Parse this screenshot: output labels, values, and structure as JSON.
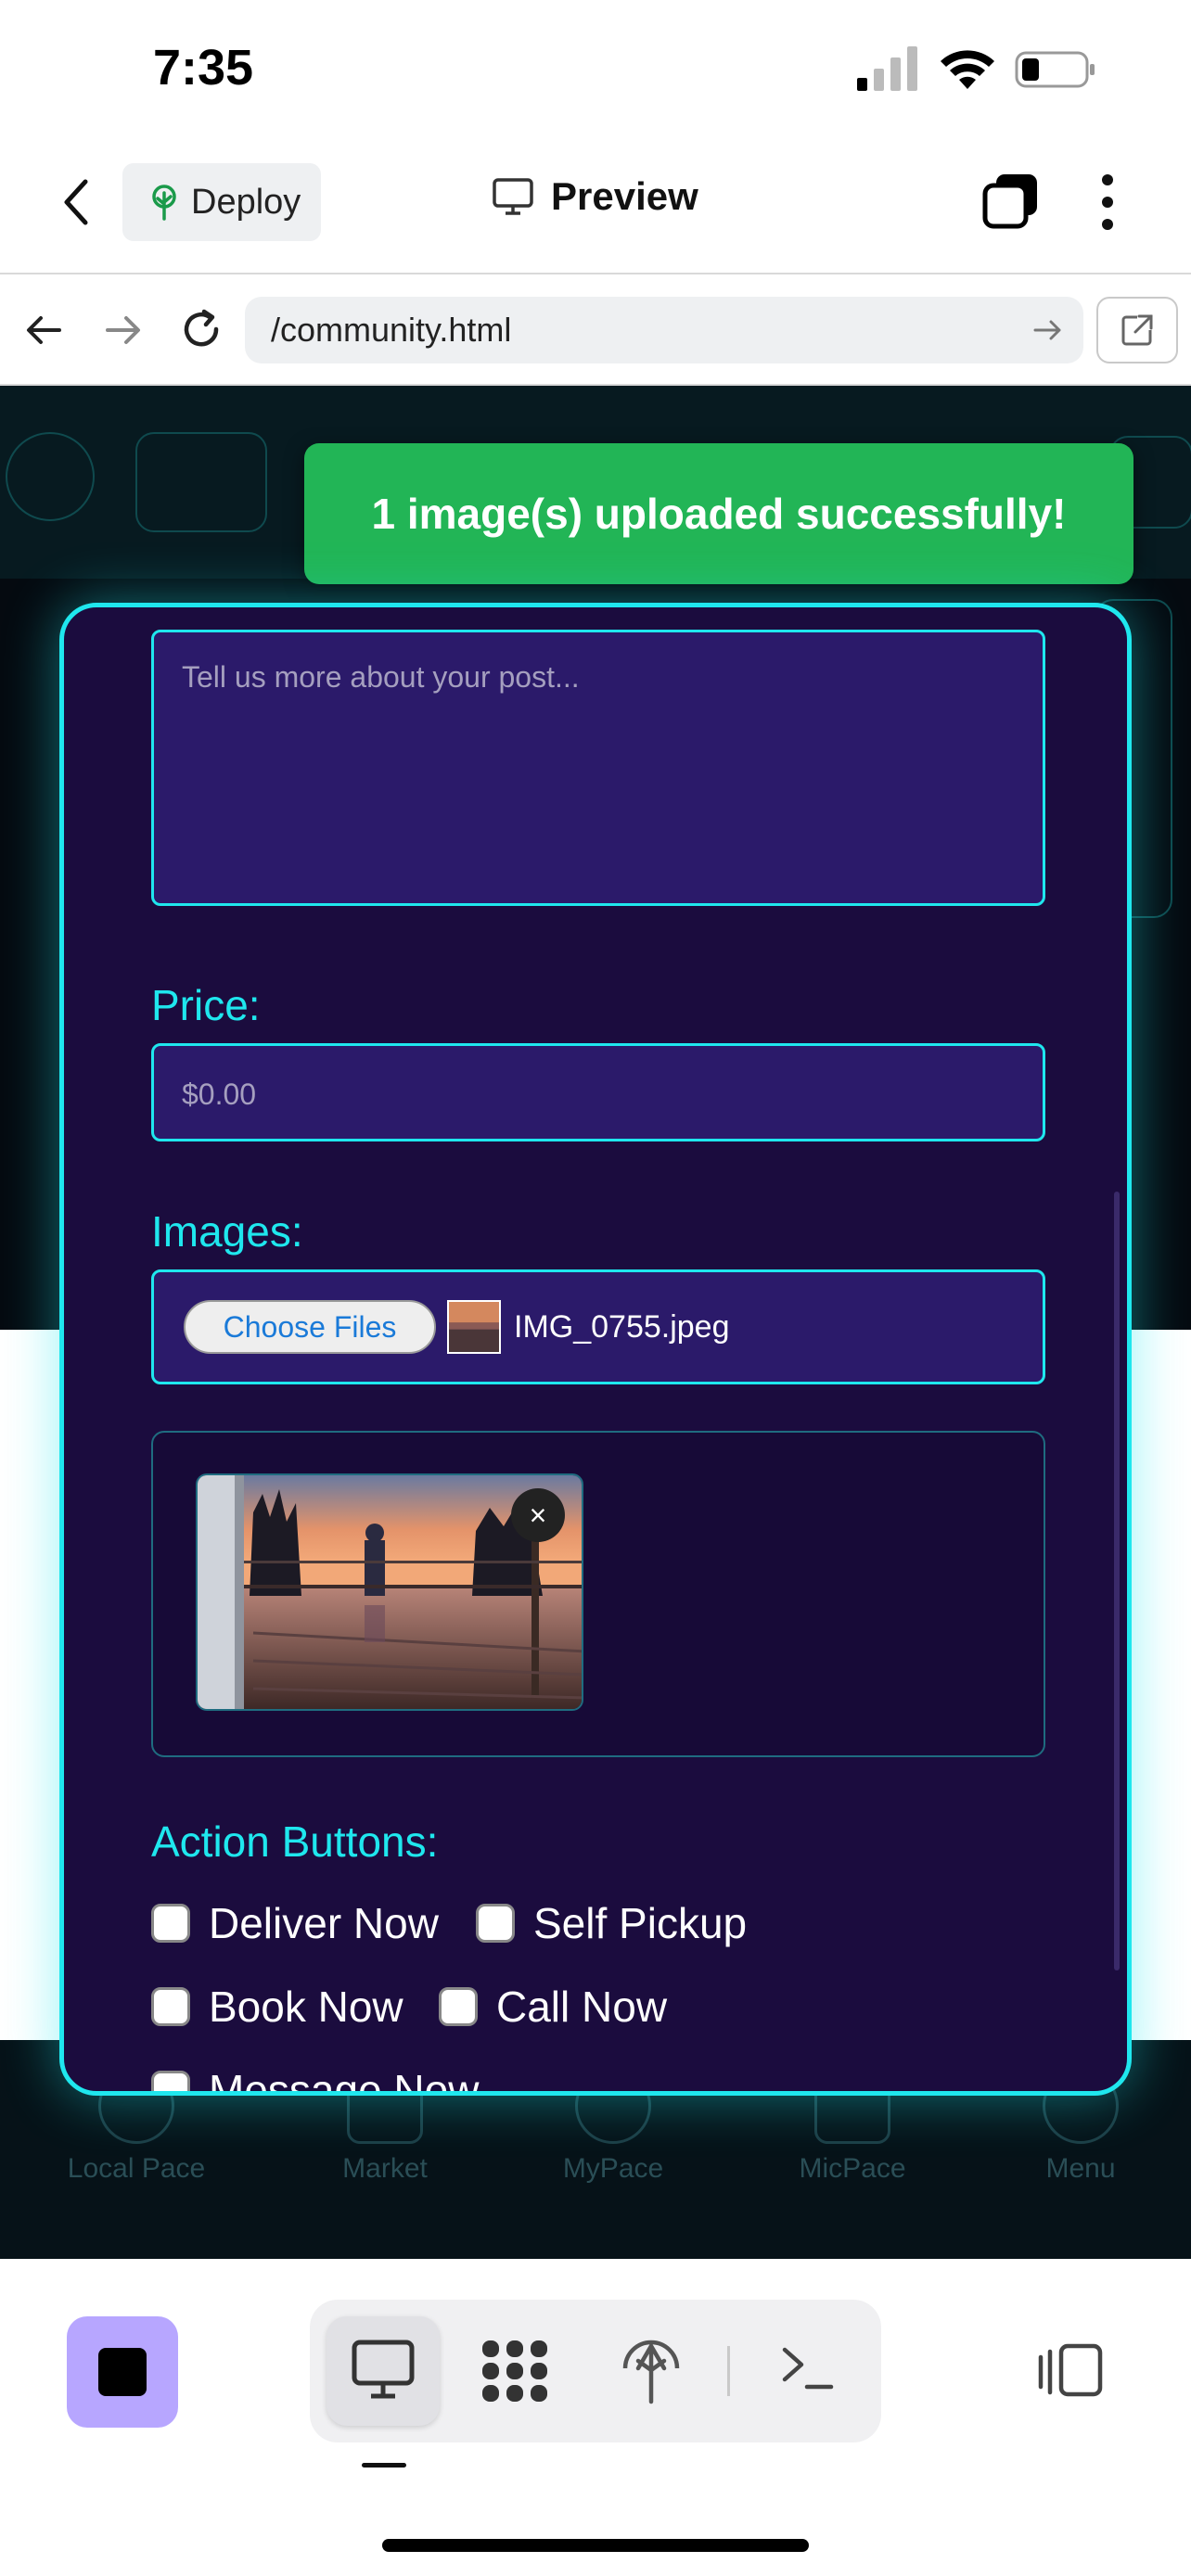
{
  "status_bar": {
    "time": "7:35"
  },
  "app_bar": {
    "deploy_label": "Deploy",
    "preview_label": "Preview"
  },
  "browser": {
    "url": "/community.html"
  },
  "toast": {
    "message": "1 image(s) uploaded successfully!"
  },
  "form": {
    "description_placeholder": "Tell us more about your post...",
    "price_label": "Price:",
    "price_placeholder": "$0.00",
    "images_label": "Images:",
    "choose_files_label": "Choose Files",
    "file_name": "IMG_0755.jpeg",
    "remove_label": "×",
    "action_buttons_label": "Action Buttons:",
    "actions": [
      {
        "label": "Deliver Now",
        "checked": false
      },
      {
        "label": "Self Pickup",
        "checked": false
      },
      {
        "label": "Book Now",
        "checked": false
      },
      {
        "label": "Call Now",
        "checked": false
      },
      {
        "label": "Message Now",
        "checked": false
      }
    ]
  },
  "background_nav": {
    "items": [
      "Local Pace",
      "Market",
      "MyPace",
      "MicPace",
      "Menu"
    ]
  },
  "colors": {
    "accent": "#1fe7ee",
    "modal_bg": "#1b0c3e",
    "field_bg": "#2b1a6a",
    "toast": "#22b556",
    "stop": "#b7a6ff"
  }
}
